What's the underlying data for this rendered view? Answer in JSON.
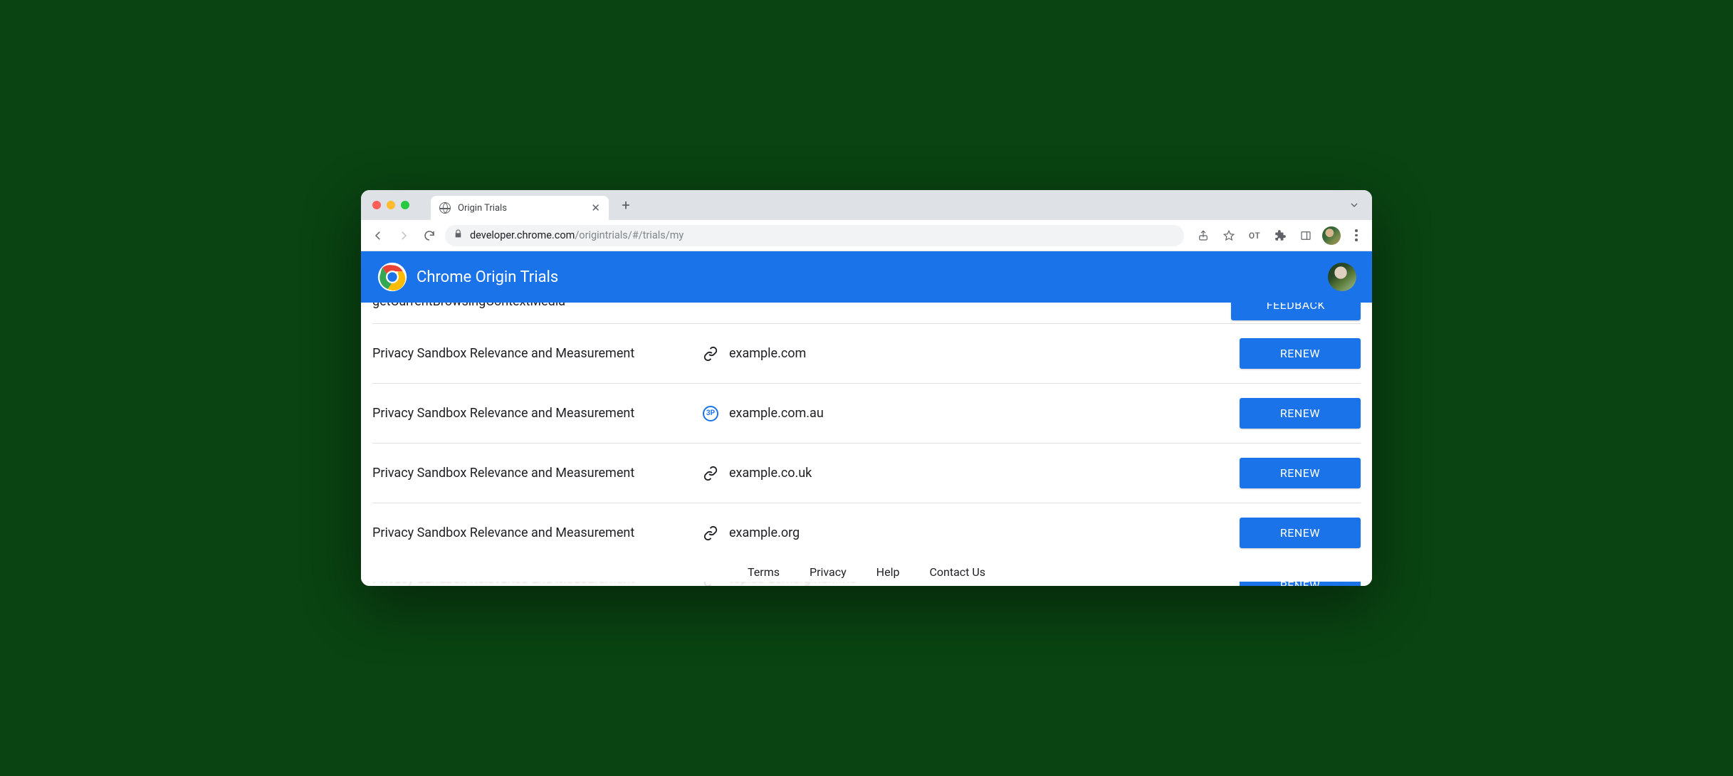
{
  "browser": {
    "tab_title": "Origin Trials",
    "url_host": "developer.chrome.com",
    "url_path": "/origintrials/#/trials/my",
    "omnibox_profile_label": "OT"
  },
  "header": {
    "title": "Chrome Origin Trials"
  },
  "top_cutoff": {
    "trial_name": "getCurrentBrowsingContextMedia",
    "button_label": "FEEDBACK"
  },
  "rows": [
    {
      "name": "Privacy Sandbox Relevance and Measurement",
      "icon": "link",
      "domain": "example.com",
      "button": "RENEW"
    },
    {
      "name": "Privacy Sandbox Relevance and Measurement",
      "icon": "thirdparty",
      "domain": "example.com.au",
      "button": "RENEW"
    },
    {
      "name": "Privacy Sandbox Relevance and Measurement",
      "icon": "link",
      "domain": "example.co.uk",
      "button": "RENEW"
    },
    {
      "name": "Privacy Sandbox Relevance and Measurement",
      "icon": "link",
      "domain": "example.org",
      "button": "RENEW"
    }
  ],
  "bottom_cutoff": {
    "name": "Privacy Sandbox Relevance and Measurement",
    "domain": "topics-demo.glitch.me",
    "button": "RENEW"
  },
  "thirdparty_badge_label": "3P",
  "footer": {
    "terms": "Terms",
    "privacy": "Privacy",
    "help": "Help",
    "contact": "Contact Us"
  }
}
